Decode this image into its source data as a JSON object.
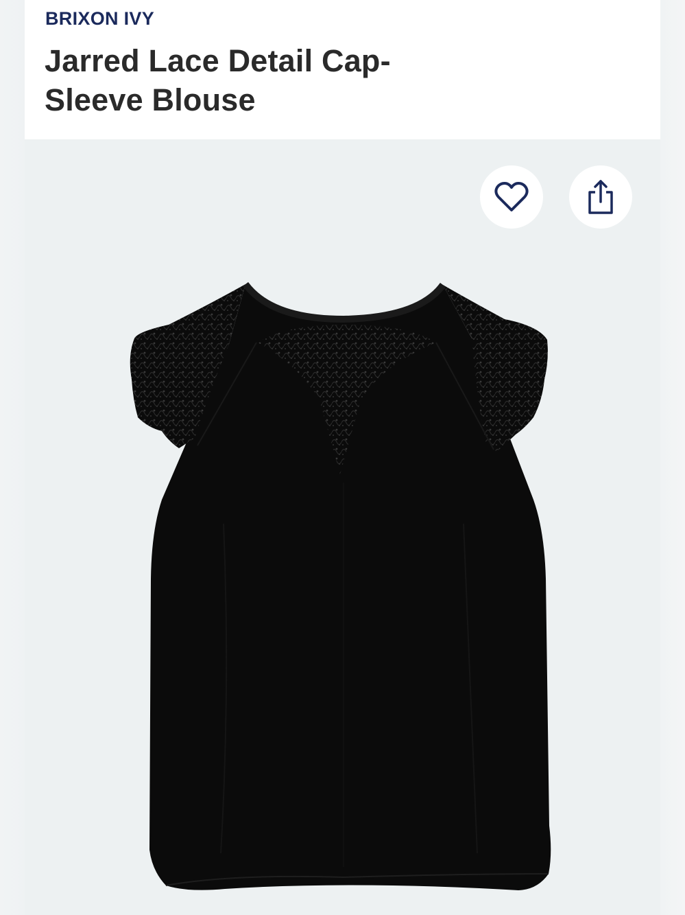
{
  "product": {
    "brand": "BRIXON IVY",
    "title": "Jarred Lace Detail Cap-Sleeve Blouse",
    "image_alt": "Black sleeveless blouse with lace cap sleeves and lace yoke"
  },
  "actions": {
    "favorite_icon": "heart-outline-icon",
    "share_icon": "share-upload-icon"
  },
  "colors": {
    "brand_text": "#1b2a5c",
    "title_text": "#2a2a2a",
    "background": "#edf1f2",
    "garment": "#0b0b0b"
  }
}
